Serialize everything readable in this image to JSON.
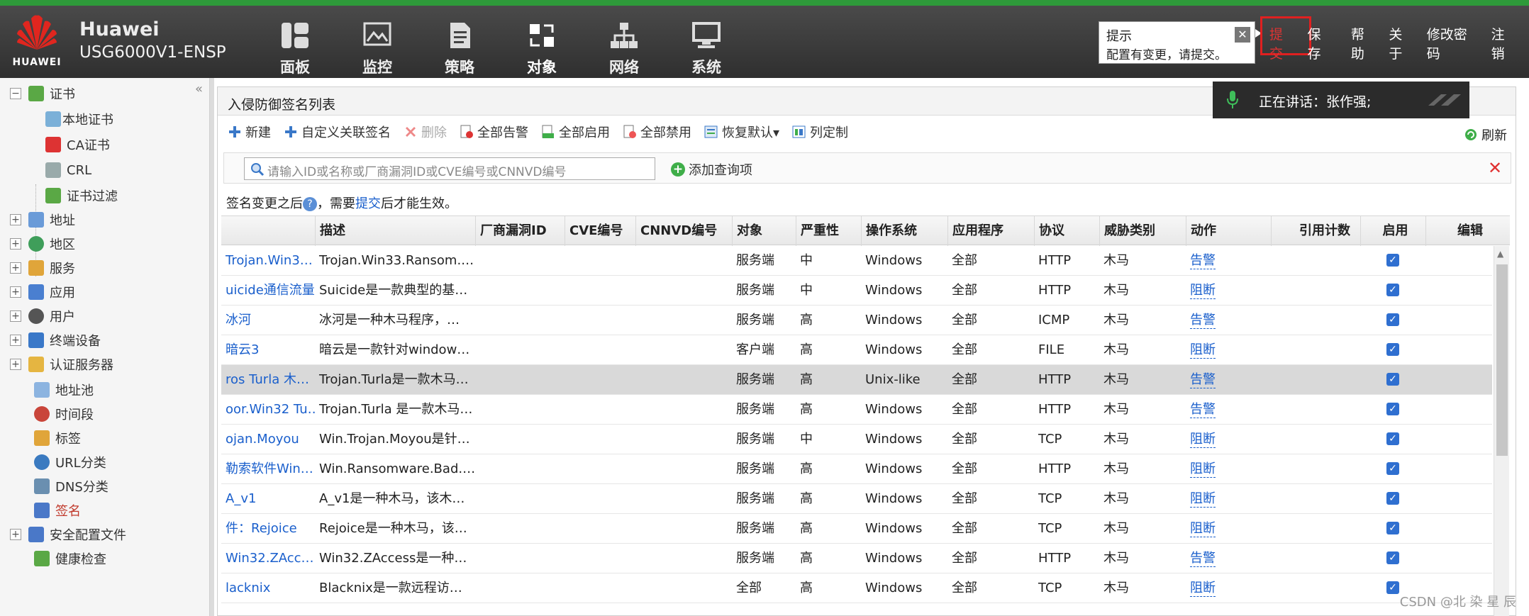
{
  "header": {
    "logo_text": "HUAWEI",
    "brand": "Huawei",
    "device": "USG6000V1-ENSP",
    "nav": [
      "面板",
      "监控",
      "策略",
      "对象",
      "网络",
      "系统"
    ],
    "tip": {
      "title": "提示",
      "message": "配置有变更，请提交。"
    },
    "links": {
      "submit": "提交",
      "save": "保存",
      "help": "帮助",
      "about": "关于",
      "change_password": "修改密码",
      "logout": "注销"
    },
    "speaking": "正在讲话：张作强;"
  },
  "sidebar": {
    "items": [
      "证书",
      "本地证书",
      "CA证书",
      "CRL",
      "证书过滤",
      "地址",
      "地区",
      "服务",
      "应用",
      "用户",
      "终端设备",
      "认证服务器",
      "地址池",
      "时间段",
      "标签",
      "URL分类",
      "DNS分类",
      "签名",
      "安全配置文件",
      "健康检查"
    ]
  },
  "panel": {
    "title": "入侵防御签名列表",
    "toolbar": [
      "新建",
      "自定义关联签名",
      "删除",
      "全部告警",
      "全部启用",
      "全部禁用",
      "恢复默认▾",
      "列定制"
    ],
    "refresh": "刷新",
    "search_placeholder": "请输入ID或名称或厂商漏洞ID或CVE编号或CNNVD编号",
    "add_query": "添加查询项",
    "notice_pre": "签名变更之后",
    "notice_mid": "，需要",
    "notice_link": "提交",
    "notice_post": "后才能生效。"
  },
  "table": {
    "headers": [
      "描述",
      "厂商漏洞ID",
      "CVE编号",
      "CNNVD编号",
      "对象",
      "严重性",
      "操作系统",
      "应用程序",
      "协议",
      "威胁类别",
      "动作",
      "引用计数",
      "启用",
      "编辑"
    ],
    "rows": [
      {
        "name": "Trojan.Win3…",
        "desc": "Trojan.Win33.Ransom.…",
        "object": "服务端",
        "severity": "中",
        "os": "Windows",
        "app": "全部",
        "proto": "HTTP",
        "threat": "木马",
        "action": "告警",
        "enabled": true
      },
      {
        "name": "uicide通信流量",
        "desc": "Suicide是一款典型的基…",
        "object": "服务端",
        "severity": "中",
        "os": "Windows",
        "app": "全部",
        "proto": "HTTP",
        "threat": "木马",
        "action": "阻断",
        "enabled": true
      },
      {
        "name": "冰河",
        "desc": "冰河是一种木马程序，…",
        "object": "服务端",
        "severity": "高",
        "os": "Windows",
        "app": "全部",
        "proto": "ICMP",
        "threat": "木马",
        "action": "告警",
        "enabled": true
      },
      {
        "name": "暗云3",
        "desc": "暗云是一款针对window…",
        "object": "客户端",
        "severity": "高",
        "os": "Windows",
        "app": "全部",
        "proto": "FILE",
        "threat": "木马",
        "action": "阻断",
        "enabled": true
      },
      {
        "name": "ros Turla 木…",
        "desc": "Trojan.Turla是一款木马…",
        "object": "服务端",
        "severity": "高",
        "os": "Unix-like",
        "app": "全部",
        "proto": "HTTP",
        "threat": "木马",
        "action": "告警",
        "enabled": true
      },
      {
        "name": "oor.Win32 Tu…",
        "desc": "Trojan.Turla 是一款木马…",
        "object": "服务端",
        "severity": "高",
        "os": "Windows",
        "app": "全部",
        "proto": "HTTP",
        "threat": "木马",
        "action": "告警",
        "enabled": true
      },
      {
        "name": "ojan.Moyou",
        "desc": "Win.Trojan.Moyou是针…",
        "object": "服务端",
        "severity": "中",
        "os": "Windows",
        "app": "全部",
        "proto": "TCP",
        "threat": "木马",
        "action": "阻断",
        "enabled": true
      },
      {
        "name": "勒索软件Win…",
        "desc": "Win.Ransomware.Bad.…",
        "object": "服务端",
        "severity": "高",
        "os": "Windows",
        "app": "全部",
        "proto": "HTTP",
        "threat": "木马",
        "action": "阻断",
        "enabled": true
      },
      {
        "name": "A_v1",
        "desc": "A_v1是一种木马，该木…",
        "object": "服务端",
        "severity": "高",
        "os": "Windows",
        "app": "全部",
        "proto": "TCP",
        "threat": "木马",
        "action": "阻断",
        "enabled": true
      },
      {
        "name": "件：Rejoice",
        "desc": "Rejoice是一种木马，该…",
        "object": "服务端",
        "severity": "高",
        "os": "Windows",
        "app": "全部",
        "proto": "TCP",
        "threat": "木马",
        "action": "阻断",
        "enabled": true
      },
      {
        "name": "Win32.ZAcc…",
        "desc": "Win32.ZAccess是一种…",
        "object": "服务端",
        "severity": "高",
        "os": "Windows",
        "app": "全部",
        "proto": "HTTP",
        "threat": "木马",
        "action": "告警",
        "enabled": true
      },
      {
        "name": "lacknix",
        "desc": "Blacknix是一款远程访…",
        "object": "全部",
        "severity": "高",
        "os": "Windows",
        "app": "全部",
        "proto": "TCP",
        "threat": "木马",
        "action": "阻断",
        "enabled": true
      }
    ]
  },
  "watermark": "CSDN @北 染 星 辰"
}
